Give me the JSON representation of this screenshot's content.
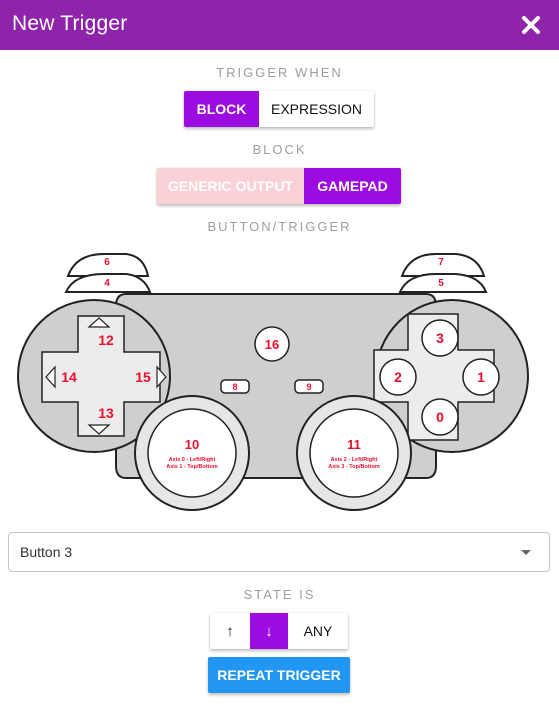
{
  "dialog": {
    "title": "New Trigger",
    "close_icon": "close-icon"
  },
  "trigger_when": {
    "label": "TRIGGER WHEN",
    "options": [
      "BLOCK",
      "EXPRESSION"
    ],
    "selected": "BLOCK"
  },
  "block": {
    "label": "BLOCK",
    "options": [
      "GENERIC OUTPUT",
      "GAMEPAD"
    ],
    "selected": "GAMEPAD"
  },
  "button_trigger": {
    "label": "BUTTON/TRIGGER",
    "gamepad": {
      "bumpers": {
        "b6": "6",
        "b4": "4",
        "b7": "7",
        "b5": "5"
      },
      "dpad": {
        "up": "12",
        "down": "13",
        "left": "14",
        "right": "15"
      },
      "center": {
        "home": "16",
        "select": "8",
        "start": "9"
      },
      "face": {
        "top": "3",
        "left": "2",
        "right": "1",
        "bottom": "0"
      },
      "left_stick": {
        "id": "10",
        "axis_line1": "Axis 0 - Left/Right",
        "axis_line2": "Axis 1 - Top/Bottom"
      },
      "right_stick": {
        "id": "11",
        "axis_line1": "Axis 2 - Left/Right",
        "axis_line2": "Axis 3 - Top/Bottom"
      }
    }
  },
  "button_select": {
    "value": "Button 3"
  },
  "state": {
    "label": "STATE IS",
    "options": [
      "↑",
      "↓",
      "ANY"
    ],
    "selected": "↓"
  },
  "repeat_trigger": {
    "label": "REPEAT TRIGGER"
  },
  "colors": {
    "header": "#8e24aa",
    "active": "#9c0be0",
    "inactive_faded": "#fbd1d8",
    "repeat_button": "#2196f3",
    "gamepad_numbers": "#e8102e"
  }
}
